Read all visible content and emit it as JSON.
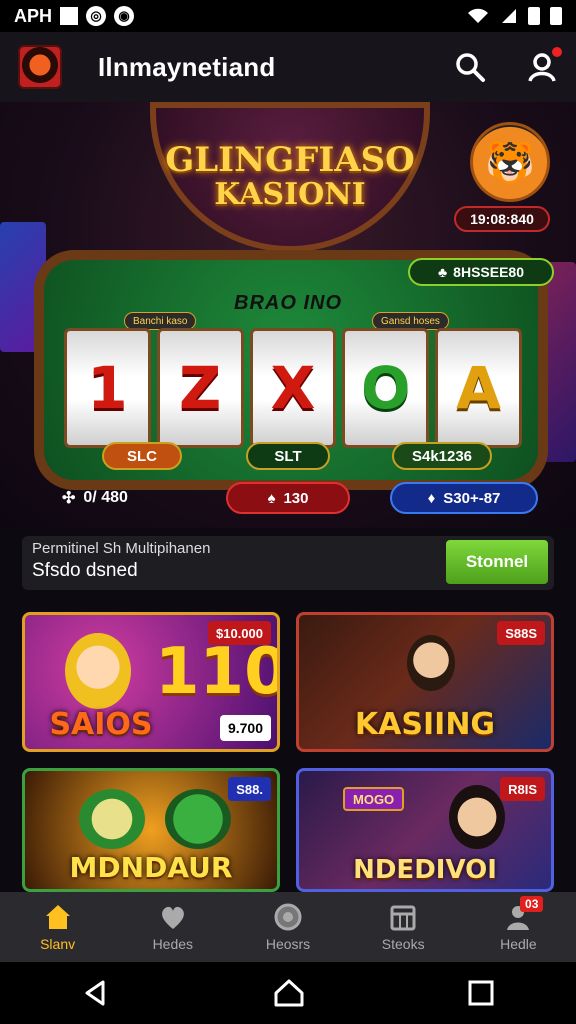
{
  "status_bar": {
    "carrier": "APH"
  },
  "app": {
    "title": "Ilnmaynetiand"
  },
  "hero": {
    "sign_line1": "GLINGFIASO",
    "sign_line2": "KASIONI",
    "timer": "19:08:840",
    "balance_chip": "8HSSEE80",
    "table_label": "BRAO INO",
    "reel_badge_left": "Banchi kaso",
    "reel_badge_right": "Gansd hoses",
    "reels": [
      "1",
      "Z",
      "X",
      "O",
      "A"
    ],
    "btn_left": "SLC",
    "btn_mid": "SLT",
    "btn_right": "S4k1236",
    "stat_plain": "0/ 480",
    "stat_red": "130",
    "stat_blue": "S30+-87"
  },
  "promo": {
    "line1": "Permitinel Sh Multipihanen",
    "line2": "Sfsdo dsned",
    "button": "Stonnel"
  },
  "cards": [
    {
      "title": "SAIOS",
      "big": "110",
      "tag": "$10.000",
      "tag2": "9.700"
    },
    {
      "title": "KASIING",
      "tag": "S88S"
    },
    {
      "title": "MDNDAUR",
      "tag": "S88."
    },
    {
      "title": "NDEDIVOI",
      "tag": "R8IS",
      "mini": "MOGO"
    }
  ],
  "bottom_nav": [
    {
      "label": "Slanv",
      "icon": "home-icon",
      "active": true
    },
    {
      "label": "Hedes",
      "icon": "heart-icon"
    },
    {
      "label": "Heosrs",
      "icon": "chip-icon"
    },
    {
      "label": "Steoks",
      "icon": "calendar-icon"
    },
    {
      "label": "Hedle",
      "icon": "profile-icon",
      "badge": "03"
    }
  ],
  "colors": {
    "accent": "#ffc020",
    "promo_green": "#6ac82e",
    "danger": "#e0201e"
  }
}
